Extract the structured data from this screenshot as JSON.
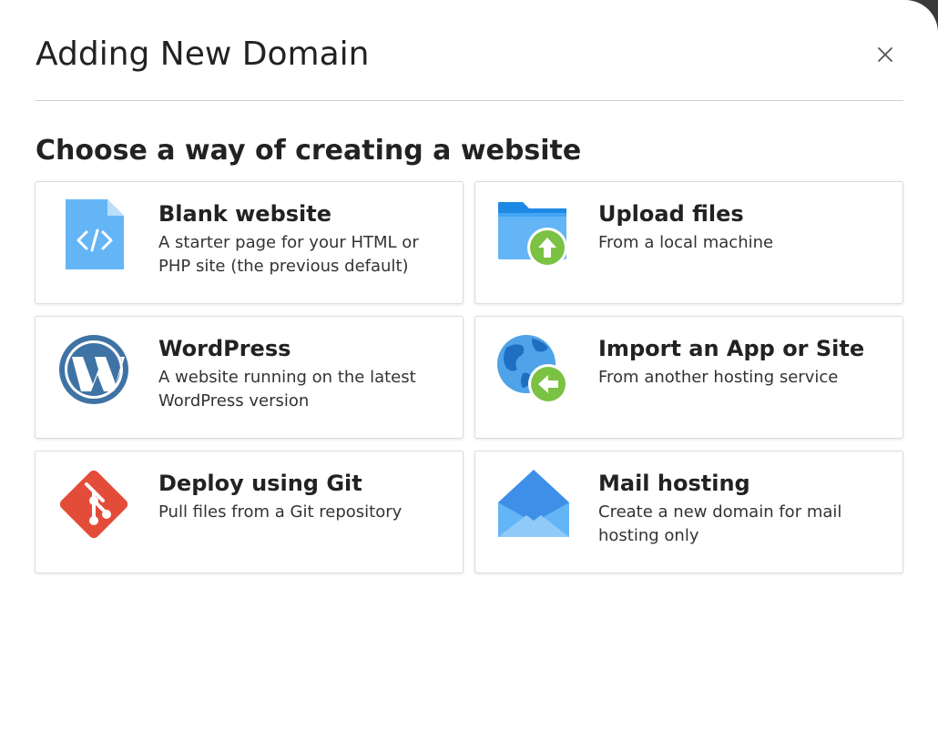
{
  "dialog": {
    "title": "Adding New Domain",
    "close_icon": "close-icon"
  },
  "section_title": "Choose a way of creating a website",
  "options": [
    {
      "title": "Blank website",
      "description": "A starter page for your HTML or PHP site (the previous default)",
      "icon": "code-file-icon"
    },
    {
      "title": "Upload files",
      "description": "From a local machine",
      "icon": "folder-upload-icon"
    },
    {
      "title": "WordPress",
      "description": "A website running on the latest WordPress version",
      "icon": "wordpress-icon"
    },
    {
      "title": "Import an App or Site",
      "description": "From another hosting service",
      "icon": "globe-import-icon"
    },
    {
      "title": "Deploy using Git",
      "description": "Pull files from a Git repository",
      "icon": "git-icon"
    },
    {
      "title": "Mail hosting",
      "description": "Create a new domain for mail hosting only",
      "icon": "envelope-icon"
    }
  ],
  "colors": {
    "file_blue": "#64B5F6",
    "folder_blue": "#42A5F5",
    "wordpress_blue": "#3F73A5",
    "globe_blue": "#4FA3E8",
    "green_badge": "#7BC143",
    "git_red": "#E44C3A",
    "envelope_blue": "#3D8FE8"
  }
}
